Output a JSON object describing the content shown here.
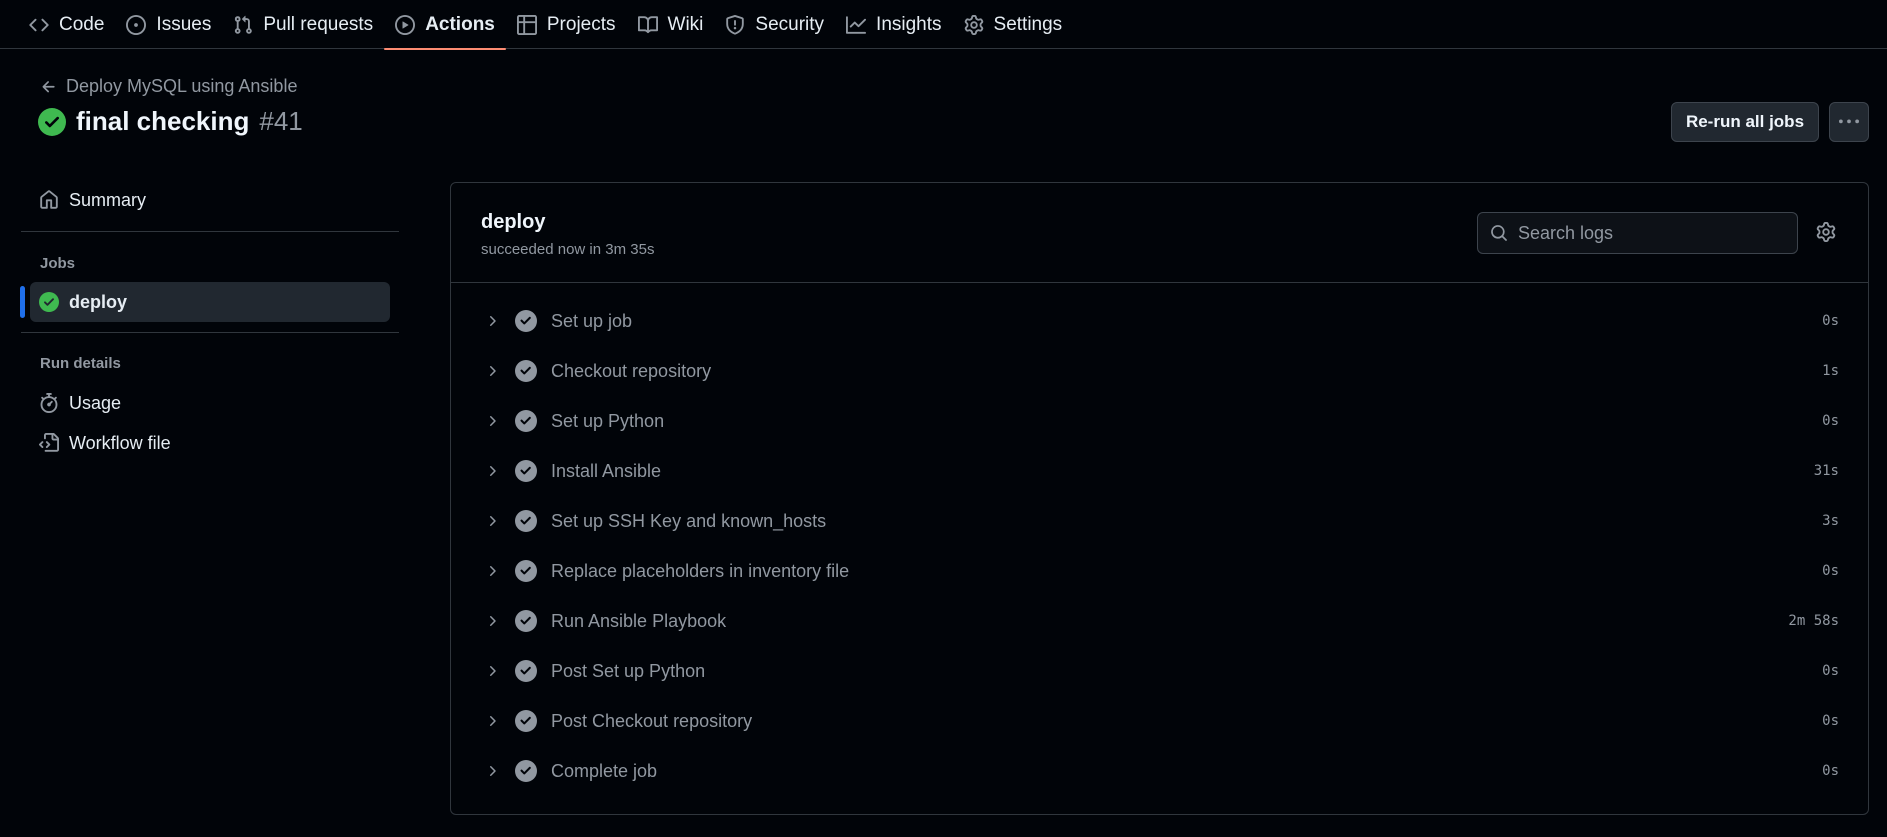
{
  "nav": {
    "tabs": [
      {
        "label": "Code",
        "icon": "code-icon"
      },
      {
        "label": "Issues",
        "icon": "issue-opened-icon"
      },
      {
        "label": "Pull requests",
        "icon": "git-pull-request-icon"
      },
      {
        "label": "Actions",
        "icon": "play-icon",
        "selected": true
      },
      {
        "label": "Projects",
        "icon": "table-icon"
      },
      {
        "label": "Wiki",
        "icon": "book-icon"
      },
      {
        "label": "Security",
        "icon": "shield-icon"
      },
      {
        "label": "Insights",
        "icon": "graph-icon"
      },
      {
        "label": "Settings",
        "icon": "gear-icon"
      }
    ]
  },
  "header": {
    "workflow_name": "Deploy MySQL using Ansible",
    "run_title": "final checking",
    "run_number": "#41",
    "rerun_label": "Re-run all jobs"
  },
  "sidebar": {
    "summary": "Summary",
    "jobs_heading": "Jobs",
    "job": "deploy",
    "run_details_heading": "Run details",
    "usage": "Usage",
    "workflow_file": "Workflow file"
  },
  "job": {
    "name": "deploy",
    "status": "succeeded now in 3m 35s",
    "search_placeholder": "Search logs",
    "steps": [
      {
        "name": "Set up job",
        "duration": "0s"
      },
      {
        "name": "Checkout repository",
        "duration": "1s"
      },
      {
        "name": "Set up Python",
        "duration": "0s"
      },
      {
        "name": "Install Ansible",
        "duration": "31s"
      },
      {
        "name": "Set up SSH Key and known_hosts",
        "duration": "3s"
      },
      {
        "name": "Replace placeholders in inventory file",
        "duration": "0s"
      },
      {
        "name": "Run Ansible Playbook",
        "duration": "2m 58s"
      },
      {
        "name": "Post Set up Python",
        "duration": "0s"
      },
      {
        "name": "Post Checkout repository",
        "duration": "0s"
      },
      {
        "name": "Complete job",
        "duration": "0s"
      }
    ]
  },
  "colors": {
    "background": "#010409",
    "success": "#3fb950",
    "selected_tab_underline": "#fd8c73",
    "active_job_bar": "#1f6feb",
    "muted_text": "#9198a1"
  }
}
